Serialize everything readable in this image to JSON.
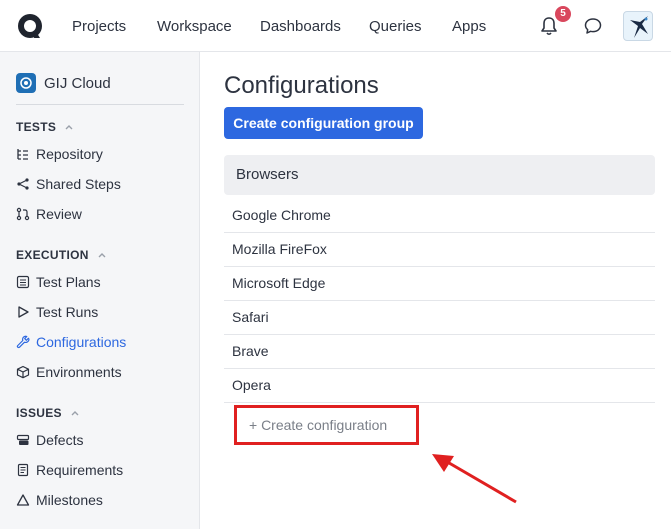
{
  "topbar": {
    "nav": [
      "Projects",
      "Workspace",
      "Dashboards",
      "Queries",
      "Apps"
    ],
    "notification_count": "5"
  },
  "sidebar": {
    "workspace": "GIJ Cloud",
    "sections": [
      {
        "title": "TESTS",
        "items": [
          "Repository",
          "Shared Steps",
          "Review"
        ]
      },
      {
        "title": "EXECUTION",
        "items": [
          "Test Plans",
          "Test Runs",
          "Configurations",
          "Environments"
        ]
      },
      {
        "title": "ISSUES",
        "items": [
          "Defects",
          "Requirements",
          "Milestones"
        ]
      }
    ],
    "active_item": "Configurations"
  },
  "main": {
    "title": "Configurations",
    "create_group_label": "Create configuration group",
    "group": {
      "name": "Browsers",
      "configs": [
        "Google Chrome",
        "Mozilla FireFox",
        "Microsoft Edge",
        "Safari",
        "Brave",
        "Opera"
      ]
    },
    "create_config_label": "+ Create configuration"
  },
  "colors": {
    "accent": "#2d68e0",
    "badge": "#d9475d",
    "highlight": "#e02020"
  }
}
